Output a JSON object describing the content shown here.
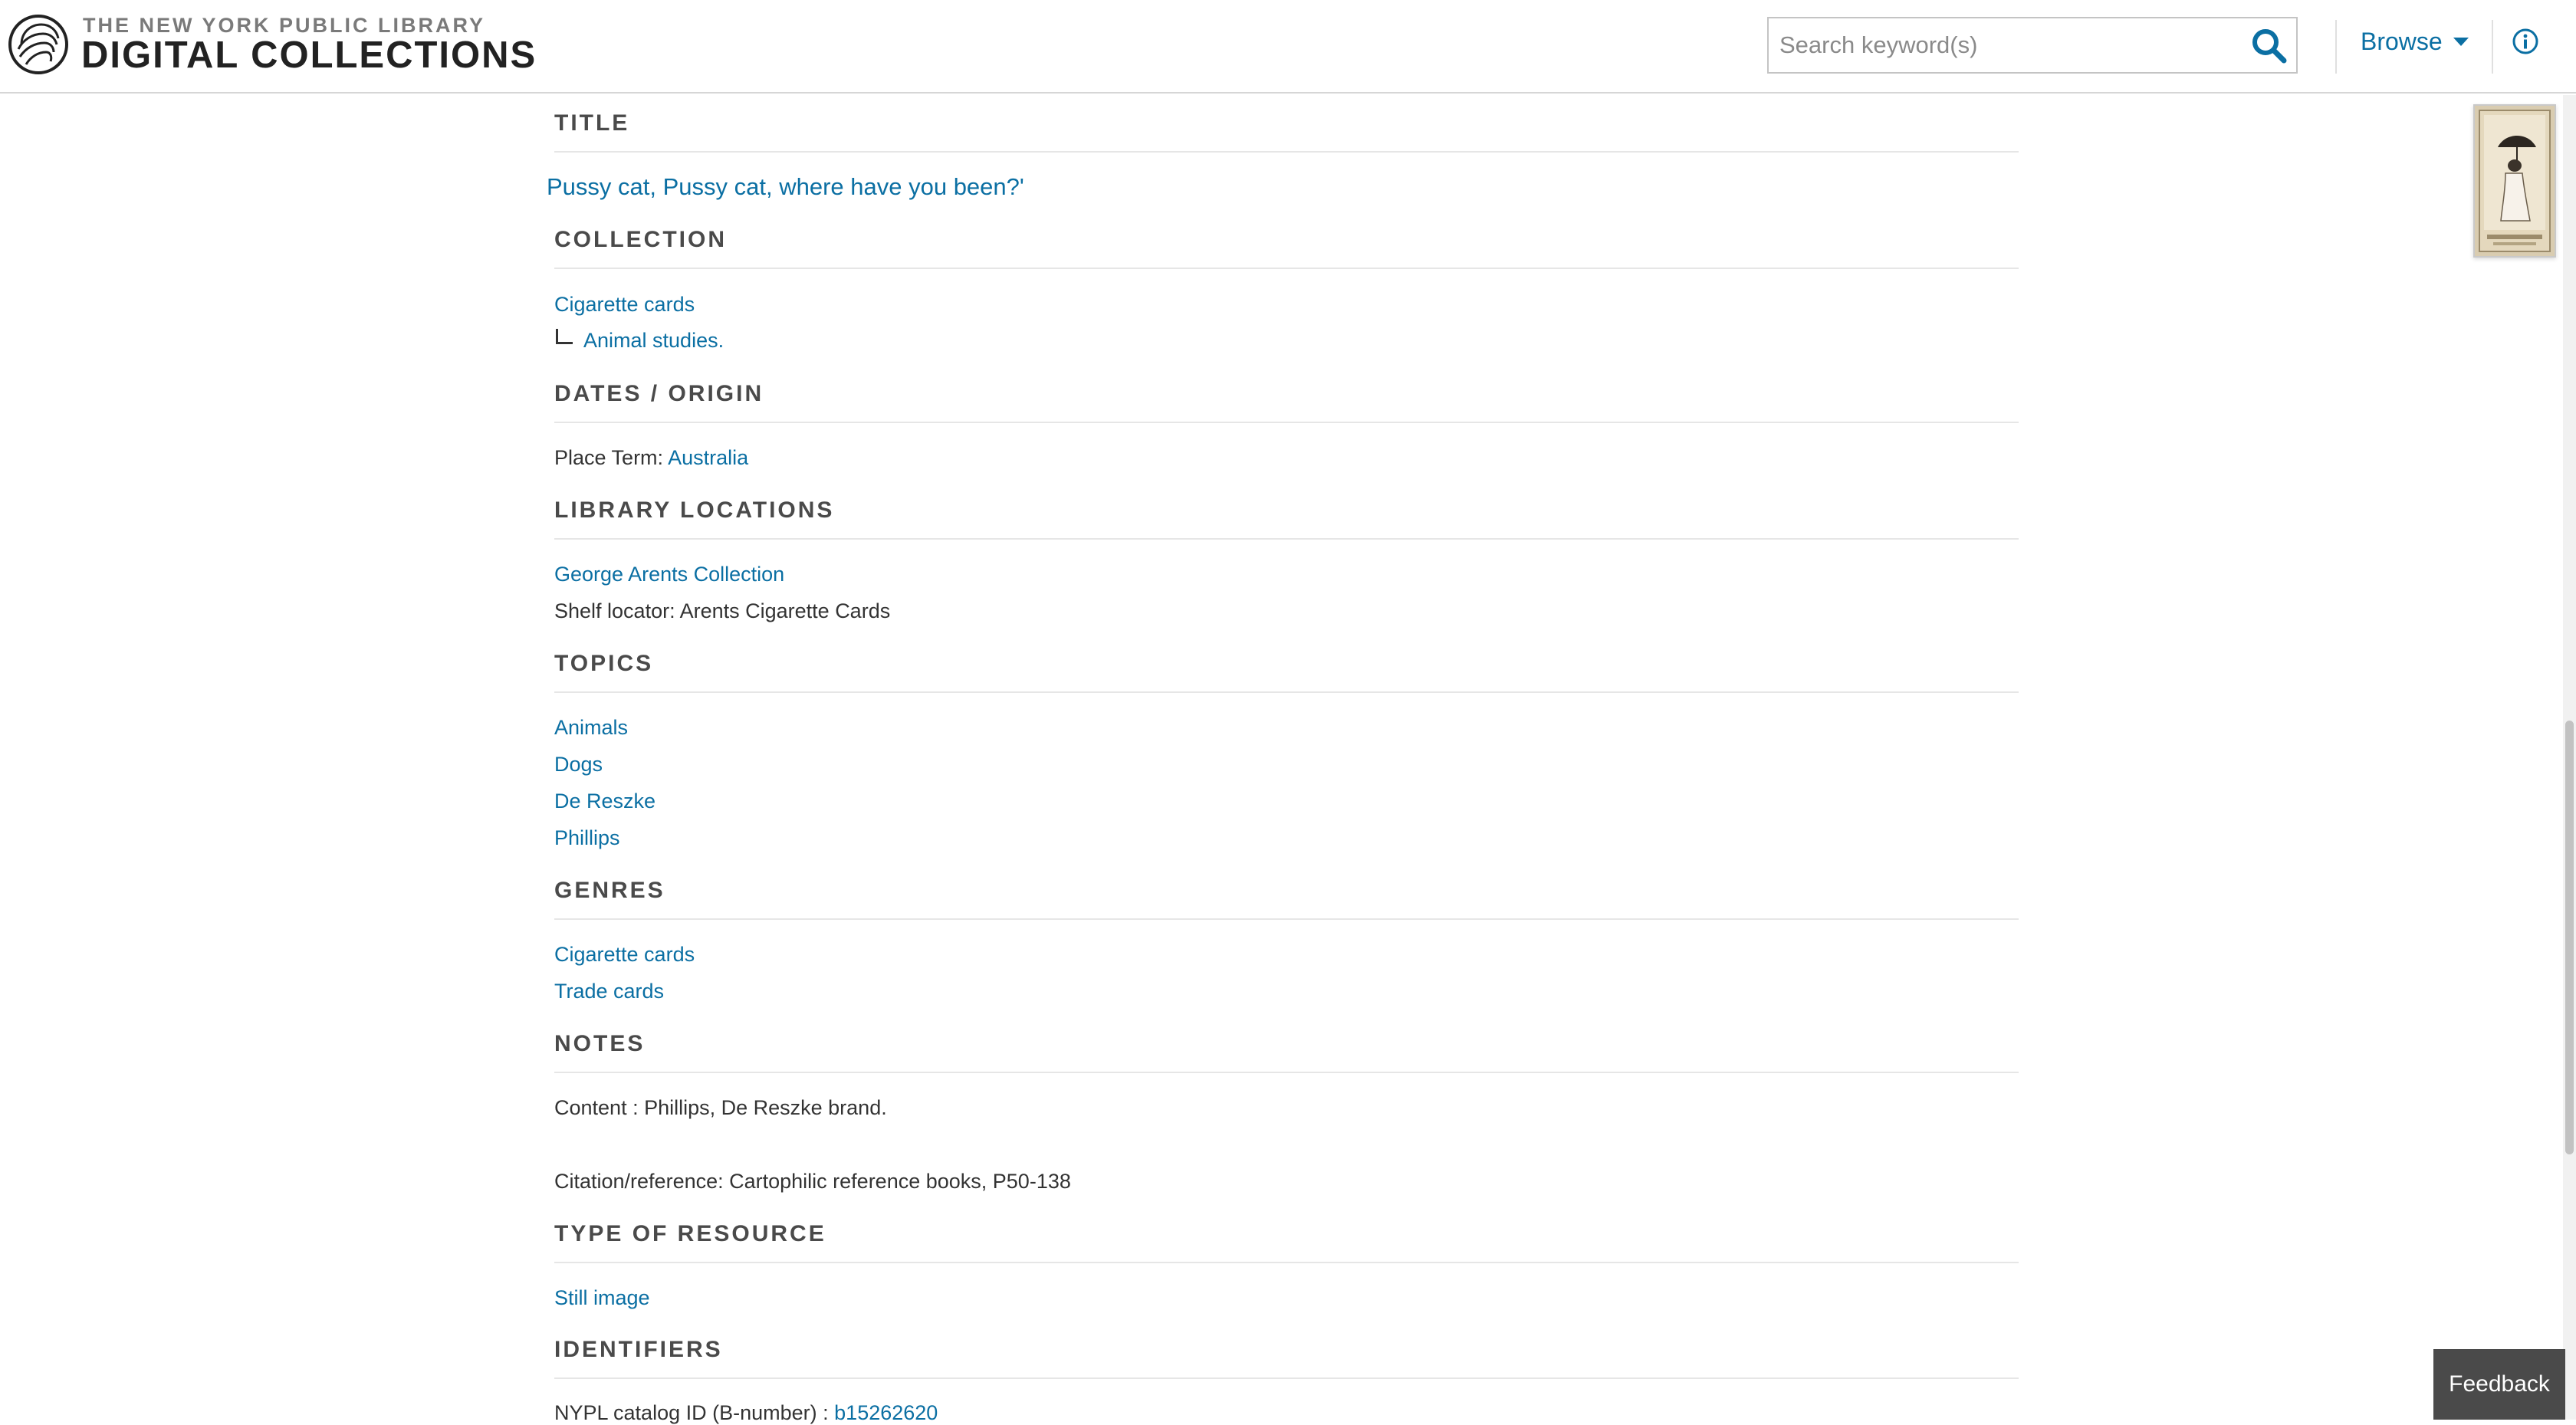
{
  "header": {
    "logo_top": "THE NEW YORK PUBLIC LIBRARY",
    "logo_main": "DIGITAL COLLECTIONS",
    "search_placeholder": "Search keyword(s)",
    "browse_label": "Browse",
    "icons": {
      "logo": "nypl-lion-icon",
      "search": "search-icon",
      "browse": "caret-down-icon",
      "info": "info-icon"
    }
  },
  "colors": {
    "link": "#0b6fa3",
    "heading": "#4a4a4a",
    "feedback_bg": "#4a4a4a"
  },
  "sections": {
    "title": {
      "heading": "TITLE",
      "value": "Pussy cat, Pussy cat, where have you been?'"
    },
    "collection": {
      "heading": "COLLECTION",
      "parent": "Cigarette cards",
      "child": "Animal studies."
    },
    "dates": {
      "heading": "DATES / ORIGIN",
      "label": "Place Term:",
      "value": "Australia"
    },
    "locations": {
      "heading": "LIBRARY LOCATIONS",
      "link": "George Arents Collection",
      "shelf": "Shelf locator: Arents Cigarette Cards"
    },
    "topics": {
      "heading": "TOPICS",
      "items": [
        "Animals",
        "Dogs",
        "De Reszke",
        "Phillips"
      ]
    },
    "genres": {
      "heading": "GENRES",
      "items": [
        "Cigarette cards",
        "Trade cards"
      ]
    },
    "notes": {
      "heading": "NOTES",
      "content": "Content : Phillips, De Reszke brand.",
      "citation": "Citation/reference: Cartophilic reference books, P50-138"
    },
    "resource": {
      "heading": "TYPE OF RESOURCE",
      "value": "Still image"
    },
    "identifiers": {
      "heading": "IDENTIFIERS",
      "label": "NYPL catalog ID (B-number) :",
      "value": "b15262620"
    }
  },
  "feedback_label": "Feedback"
}
